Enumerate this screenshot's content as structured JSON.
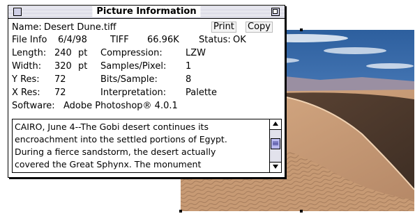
{
  "window": {
    "title": "Picture Information",
    "print_label": "Print",
    "copy_label": "Copy"
  },
  "info": {
    "name_label": "Name:",
    "name_value": "Desert Dune.tiff",
    "fileinfo_label": "File Info",
    "date": "6/4/98",
    "type": "TIFF",
    "size": "66.96K",
    "status_label": "Status:",
    "status_value": "OK",
    "length_label": "Length:",
    "length_value": "240",
    "length_unit": "pt",
    "compression_label": "Compression:",
    "compression_value": "LZW",
    "width_label": "Width:",
    "width_value": "320",
    "width_unit": "pt",
    "samples_label": "Samples/Pixel:",
    "samples_value": "1",
    "yres_label": "Y Res:",
    "yres_value": "72",
    "bits_label": "Bits/Sample:",
    "bits_value": "8",
    "xres_label": "X Res:",
    "xres_value": "72",
    "interp_label": "Interpretation:",
    "interp_value": "Palette",
    "software_label": "Software:",
    "software_value": "Adobe Photoshop® 4.0.1"
  },
  "caption": {
    "lines": [
      "CAIRO, June 4--The Gobi desert continues its",
      "encroachment into the settled portions of Egypt.",
      "During a fierce sandstorm, the desert actually",
      "covered the Great Sphynx. The monument"
    ]
  },
  "icons": {
    "close": "close-box-icon",
    "zoom": "zoom-box-icon",
    "scroll_up": "scroll-up-arrow-icon",
    "scroll_down": "scroll-down-arrow-icon"
  },
  "colors": {
    "sky": "#3b6fb4",
    "sand_light": "#e2b890",
    "sand_dark": "#6b4f3c",
    "scroll_thumb": "#b8b8ee"
  }
}
